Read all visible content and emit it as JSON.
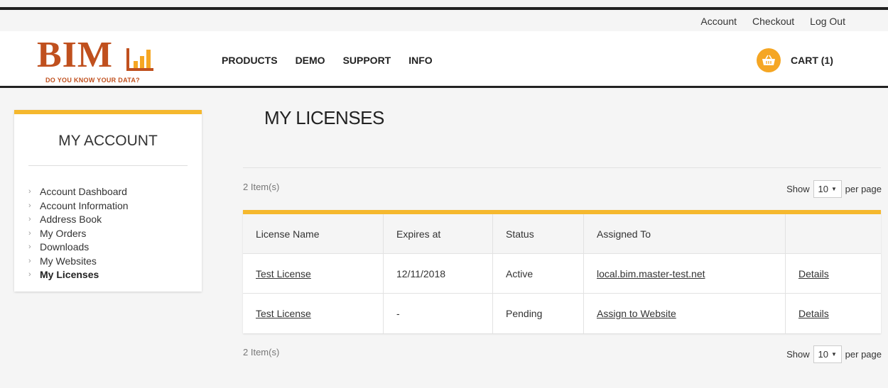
{
  "top_links": [
    "Account",
    "Checkout",
    "Log Out"
  ],
  "logo": {
    "text": "BIM",
    "tagline": "Do you know your data?"
  },
  "nav": [
    "PRODUCTS",
    "DEMO",
    "SUPPORT",
    "INFO"
  ],
  "cart": {
    "label": "CART (1)",
    "icon": "basket-icon"
  },
  "sidebar": {
    "title": "MY ACCOUNT",
    "items": [
      {
        "label": "Account Dashboard"
      },
      {
        "label": "Account Information"
      },
      {
        "label": "Address Book"
      },
      {
        "label": "My Orders"
      },
      {
        "label": "Downloads"
      },
      {
        "label": "My Websites"
      },
      {
        "label": "My Licenses"
      }
    ]
  },
  "main": {
    "title": "MY LICENSES",
    "count_label": "2 Item(s)",
    "show_label": "Show",
    "per_page_value": "10",
    "per_page_label": "per page",
    "table": {
      "headers": [
        "License Name",
        "Expires at",
        "Status",
        "Assigned To",
        ""
      ],
      "rows": [
        [
          "Test License",
          "12/11/2018",
          "Active",
          "local.bim.master-test.net",
          "Details"
        ],
        [
          "Test License",
          "-",
          "Pending",
          "Assign to Website",
          "Details"
        ]
      ]
    }
  },
  "colors": {
    "accent": "#f5b82e",
    "brand": "#c0501e",
    "cart": "#f5a623"
  }
}
